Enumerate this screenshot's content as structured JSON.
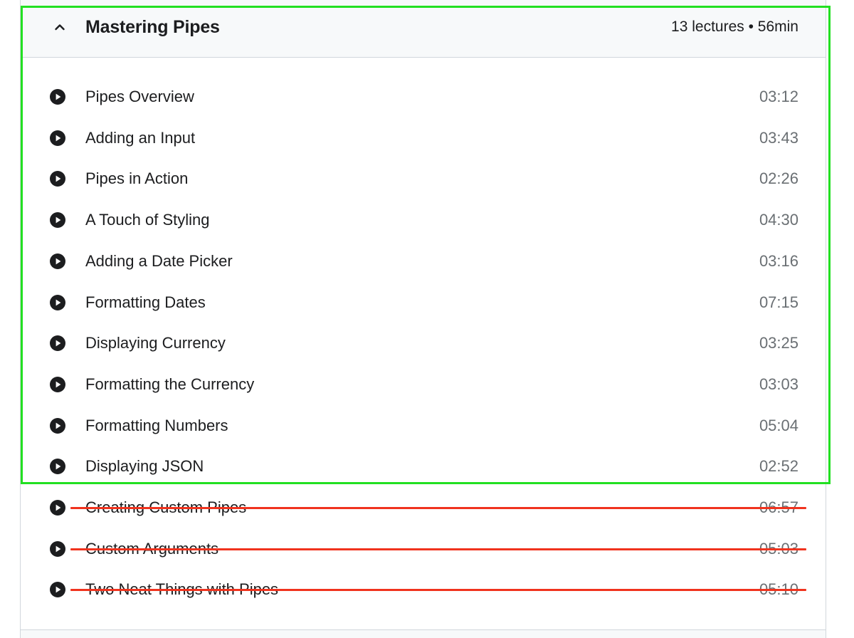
{
  "section": {
    "title": "Mastering Pipes",
    "meta": "13 lectures • 56min",
    "toggle_icon": "chevron-up-icon"
  },
  "lectures": [
    {
      "title": "Pipes Overview",
      "duration": "03:12",
      "struck_through": false
    },
    {
      "title": "Adding an Input",
      "duration": "03:43",
      "struck_through": false
    },
    {
      "title": "Pipes in Action",
      "duration": "02:26",
      "struck_through": false
    },
    {
      "title": "A Touch of Styling",
      "duration": "04:30",
      "struck_through": false
    },
    {
      "title": "Adding a Date Picker",
      "duration": "03:16",
      "struck_through": false
    },
    {
      "title": "Formatting Dates",
      "duration": "07:15",
      "struck_through": false
    },
    {
      "title": "Displaying Currency",
      "duration": "03:25",
      "struck_through": false
    },
    {
      "title": "Formatting the Currency",
      "duration": "03:03",
      "struck_through": false
    },
    {
      "title": "Formatting Numbers",
      "duration": "05:04",
      "struck_through": false
    },
    {
      "title": "Displaying JSON",
      "duration": "02:52",
      "struck_through": false
    },
    {
      "title": "Creating Custom Pipes",
      "duration": "06:57",
      "struck_through": true
    },
    {
      "title": "Custom Arguments",
      "duration": "05:03",
      "struck_through": true
    },
    {
      "title": "Two Neat Things with Pipes",
      "duration": "05:10",
      "struck_through": true
    }
  ],
  "icons": {
    "lecture": "play-circle-icon"
  },
  "colors": {
    "highlight": "#22e021",
    "strike": "#f0331e",
    "header_bg": "#f7f9fa",
    "text": "#1c1d1f",
    "duration_text": "#6a6f73"
  }
}
